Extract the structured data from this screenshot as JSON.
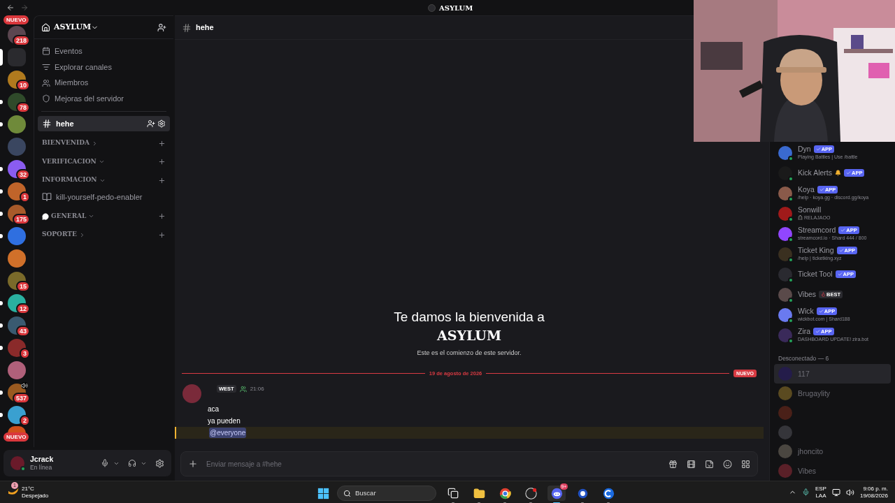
{
  "title_bar": {
    "title": "ASYLUM"
  },
  "rail": {
    "top_pill": "NUEVO",
    "bottom_pill": "NUEVO",
    "servers": [
      {
        "badge": "218",
        "unread": false,
        "selected": false,
        "voice": false,
        "color": "#5b4650"
      },
      {
        "unread": false,
        "selected": true,
        "voice": false,
        "color": "#2a2a2e"
      },
      {
        "badge": "10",
        "unread": false,
        "selected": false,
        "voice": false,
        "color": "#b07a1e"
      },
      {
        "badge": "78",
        "unread": true,
        "selected": false,
        "voice": false,
        "color": "#2f4a2a"
      },
      {
        "unread": true,
        "selected": false,
        "voice": false,
        "color": "#6f8a3a"
      },
      {
        "unread": false,
        "selected": false,
        "voice": false,
        "color": "#3a4660"
      },
      {
        "badge": "32",
        "unread": true,
        "selected": false,
        "voice": false,
        "color": "#8a5cf0"
      },
      {
        "badge": "1",
        "unread": true,
        "selected": false,
        "voice": false,
        "color": "#c0642a"
      },
      {
        "badge": "175",
        "unread": true,
        "selected": false,
        "voice": false,
        "color": "#a85a2a"
      },
      {
        "unread": true,
        "selected": false,
        "voice": false,
        "color": "#2f6fe0"
      },
      {
        "unread": false,
        "selected": false,
        "voice": false,
        "color": "#d0702a"
      },
      {
        "badge": "15",
        "unread": false,
        "selected": false,
        "voice": false,
        "color": "#7a6a2a"
      },
      {
        "badge": "12",
        "unread": true,
        "selected": false,
        "voice": false,
        "color": "#2ab0a0"
      },
      {
        "badge": "43",
        "unread": true,
        "selected": false,
        "voice": false,
        "color": "#3a5a70"
      },
      {
        "badge": "3",
        "unread": true,
        "selected": false,
        "voice": false,
        "color": "#8a2a2a"
      },
      {
        "unread": false,
        "selected": false,
        "voice": false,
        "color": "#b0607a"
      },
      {
        "badge": "537",
        "unread": true,
        "selected": false,
        "voice": true,
        "color": "#9a5a20"
      },
      {
        "badge": "2",
        "unread": true,
        "selected": false,
        "voice": false,
        "color": "#3aa0d0"
      },
      {
        "unread": false,
        "selected": false,
        "voice": false,
        "color": "#d0501a"
      }
    ]
  },
  "sidebar": {
    "server_name": "ASYLUM",
    "menu": [
      {
        "kind": "events",
        "label": "Eventos"
      },
      {
        "kind": "browse",
        "label": "Explorar canales"
      },
      {
        "kind": "members",
        "label": "Miembros"
      },
      {
        "kind": "boost",
        "label": "Mejoras del servidor"
      }
    ],
    "channels": [
      {
        "kind": "text",
        "name": "hehe",
        "selected": true
      }
    ],
    "categories": [
      {
        "name": "BIENVENIDA",
        "expanded": false,
        "kind": "plain"
      },
      {
        "name": "VERIFICACION",
        "expanded": true,
        "kind": "plain"
      },
      {
        "name": "INFORMACION",
        "expanded": true,
        "kind": "plain",
        "channels": [
          {
            "kind": "rules",
            "name": "kill-yourself-pedo-enabler",
            "selected": false
          }
        ]
      },
      {
        "name": "GENERAL",
        "expanded": true,
        "kind": "bubble"
      },
      {
        "name": "SOPORTE",
        "expanded": false,
        "kind": "plain"
      }
    ]
  },
  "user_panel": {
    "name": "Jcrack",
    "status": "En línea",
    "online": true
  },
  "main": {
    "channel": "hehe",
    "welcome": {
      "title": "Te damos la bienvenida a",
      "server": "ASYLUM",
      "subtitle": "Este es el comienzo de este servidor."
    },
    "divider": {
      "date": "19 de agosto de 2026",
      "pill": "NUEVO"
    },
    "message": {
      "tag": "WEST",
      "time": "21:06",
      "lines": [
        {
          "text": "aca",
          "mention": false
        },
        {
          "text": "ya pueden",
          "mention": false
        },
        {
          "text": "@everyone",
          "mention": true
        }
      ]
    },
    "composer": {
      "placeholder": "Enviar mensaje a #hehe"
    }
  },
  "members": {
    "online": [
      {
        "name": "Dyn",
        "subtitle": "Playing Battles | Use /battle",
        "color": "#3a6ad0",
        "badges": [
          {
            "kind": "app",
            "label": "APP"
          }
        ]
      },
      {
        "name": "Kick Alerts",
        "color": "#1a1a1a",
        "kind": "bell",
        "badges": [
          {
            "kind": "app",
            "label": "APP"
          }
        ]
      },
      {
        "name": "Koya",
        "subtitle": "/help · koya.gg · discord.gg/koya",
        "color": "#8a5a4a",
        "badges": [
          {
            "kind": "app",
            "label": "APP"
          }
        ]
      },
      {
        "name": "Sonwill",
        "subtitle": "RELAJAOO",
        "kind": "alien",
        "color": "#a01a1a"
      },
      {
        "name": "Streamcord",
        "subtitle": "streamcord.io · Shard 444 / 800",
        "color": "#9146ff",
        "badges": [
          {
            "kind": "app",
            "label": "APP"
          }
        ]
      },
      {
        "name": "Ticket King",
        "subtitle": "/help | ticketking.xyz",
        "color": "#3a3020",
        "badges": [
          {
            "kind": "app",
            "label": "APP"
          }
        ]
      },
      {
        "name": "Ticket Tool",
        "color": "#2a2a30",
        "badges": [
          {
            "kind": "app",
            "label": "APP"
          }
        ]
      },
      {
        "name": "Vibes",
        "color": "#5a4a4a",
        "badges": [
          {
            "kind": "tag",
            "label": "BEST"
          }
        ]
      },
      {
        "name": "Wick",
        "subtitle": "wickbot.com | Shard188",
        "color": "#6a7af0",
        "badges": [
          {
            "kind": "app",
            "label": "APP"
          }
        ]
      },
      {
        "name": "Zira",
        "subtitle": "DASHBOARD UPDATE! zira.bot",
        "color": "#3a2a5a",
        "badges": [
          {
            "kind": "app",
            "label": "APP"
          }
        ]
      }
    ],
    "offline_heading": "Desconectado — 6",
    "offline": [
      {
        "name": "117",
        "color": "#241c4a",
        "hovered": true
      },
      {
        "name": "Brugaylity",
        "color": "#5a4a20",
        "hovered": false
      },
      {
        "color": "#4a2018",
        "hovered": false
      },
      {
        "color": "#35353a",
        "hovered": false
      },
      {
        "name": "jhoncito",
        "color": "#4a4640",
        "hovered": false
      },
      {
        "name": "Vibes",
        "color": "#5a2028",
        "hovered": false
      }
    ]
  },
  "taskbar": {
    "weather": {
      "alert": "1",
      "temp": "21°C",
      "desc": "Despejado"
    },
    "search": {
      "placeholder": "Buscar"
    },
    "apps": [
      {
        "kind": "taskview",
        "active": false
      },
      {
        "kind": "files",
        "active": false
      },
      {
        "kind": "chrome",
        "active": false
      },
      {
        "kind": "obs",
        "active": false
      },
      {
        "kind": "discord",
        "active": true,
        "badge": "9+"
      },
      {
        "kind": "orb",
        "active": false
      },
      {
        "kind": "ring",
        "active": false
      }
    ],
    "tray": {
      "lang": "ESP",
      "layout": "LAA",
      "time": "9:06 p. m.",
      "date": "19/08/2026"
    }
  }
}
